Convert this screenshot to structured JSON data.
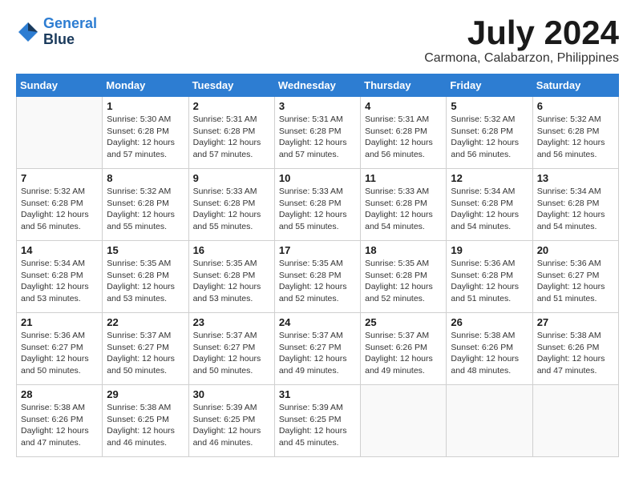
{
  "header": {
    "logo_line1": "General",
    "logo_line2": "Blue",
    "month_year": "July 2024",
    "location": "Carmona, Calabarzon, Philippines"
  },
  "days_of_week": [
    "Sunday",
    "Monday",
    "Tuesday",
    "Wednesday",
    "Thursday",
    "Friday",
    "Saturday"
  ],
  "weeks": [
    [
      {
        "day": "",
        "detail": ""
      },
      {
        "day": "1",
        "detail": "Sunrise: 5:30 AM\nSunset: 6:28 PM\nDaylight: 12 hours\nand 57 minutes."
      },
      {
        "day": "2",
        "detail": "Sunrise: 5:31 AM\nSunset: 6:28 PM\nDaylight: 12 hours\nand 57 minutes."
      },
      {
        "day": "3",
        "detail": "Sunrise: 5:31 AM\nSunset: 6:28 PM\nDaylight: 12 hours\nand 57 minutes."
      },
      {
        "day": "4",
        "detail": "Sunrise: 5:31 AM\nSunset: 6:28 PM\nDaylight: 12 hours\nand 56 minutes."
      },
      {
        "day": "5",
        "detail": "Sunrise: 5:32 AM\nSunset: 6:28 PM\nDaylight: 12 hours\nand 56 minutes."
      },
      {
        "day": "6",
        "detail": "Sunrise: 5:32 AM\nSunset: 6:28 PM\nDaylight: 12 hours\nand 56 minutes."
      }
    ],
    [
      {
        "day": "7",
        "detail": "Sunrise: 5:32 AM\nSunset: 6:28 PM\nDaylight: 12 hours\nand 56 minutes."
      },
      {
        "day": "8",
        "detail": "Sunrise: 5:32 AM\nSunset: 6:28 PM\nDaylight: 12 hours\nand 55 minutes."
      },
      {
        "day": "9",
        "detail": "Sunrise: 5:33 AM\nSunset: 6:28 PM\nDaylight: 12 hours\nand 55 minutes."
      },
      {
        "day": "10",
        "detail": "Sunrise: 5:33 AM\nSunset: 6:28 PM\nDaylight: 12 hours\nand 55 minutes."
      },
      {
        "day": "11",
        "detail": "Sunrise: 5:33 AM\nSunset: 6:28 PM\nDaylight: 12 hours\nand 54 minutes."
      },
      {
        "day": "12",
        "detail": "Sunrise: 5:34 AM\nSunset: 6:28 PM\nDaylight: 12 hours\nand 54 minutes."
      },
      {
        "day": "13",
        "detail": "Sunrise: 5:34 AM\nSunset: 6:28 PM\nDaylight: 12 hours\nand 54 minutes."
      }
    ],
    [
      {
        "day": "14",
        "detail": "Sunrise: 5:34 AM\nSunset: 6:28 PM\nDaylight: 12 hours\nand 53 minutes."
      },
      {
        "day": "15",
        "detail": "Sunrise: 5:35 AM\nSunset: 6:28 PM\nDaylight: 12 hours\nand 53 minutes."
      },
      {
        "day": "16",
        "detail": "Sunrise: 5:35 AM\nSunset: 6:28 PM\nDaylight: 12 hours\nand 53 minutes."
      },
      {
        "day": "17",
        "detail": "Sunrise: 5:35 AM\nSunset: 6:28 PM\nDaylight: 12 hours\nand 52 minutes."
      },
      {
        "day": "18",
        "detail": "Sunrise: 5:35 AM\nSunset: 6:28 PM\nDaylight: 12 hours\nand 52 minutes."
      },
      {
        "day": "19",
        "detail": "Sunrise: 5:36 AM\nSunset: 6:28 PM\nDaylight: 12 hours\nand 51 minutes."
      },
      {
        "day": "20",
        "detail": "Sunrise: 5:36 AM\nSunset: 6:27 PM\nDaylight: 12 hours\nand 51 minutes."
      }
    ],
    [
      {
        "day": "21",
        "detail": "Sunrise: 5:36 AM\nSunset: 6:27 PM\nDaylight: 12 hours\nand 50 minutes."
      },
      {
        "day": "22",
        "detail": "Sunrise: 5:37 AM\nSunset: 6:27 PM\nDaylight: 12 hours\nand 50 minutes."
      },
      {
        "day": "23",
        "detail": "Sunrise: 5:37 AM\nSunset: 6:27 PM\nDaylight: 12 hours\nand 50 minutes."
      },
      {
        "day": "24",
        "detail": "Sunrise: 5:37 AM\nSunset: 6:27 PM\nDaylight: 12 hours\nand 49 minutes."
      },
      {
        "day": "25",
        "detail": "Sunrise: 5:37 AM\nSunset: 6:26 PM\nDaylight: 12 hours\nand 49 minutes."
      },
      {
        "day": "26",
        "detail": "Sunrise: 5:38 AM\nSunset: 6:26 PM\nDaylight: 12 hours\nand 48 minutes."
      },
      {
        "day": "27",
        "detail": "Sunrise: 5:38 AM\nSunset: 6:26 PM\nDaylight: 12 hours\nand 47 minutes."
      }
    ],
    [
      {
        "day": "28",
        "detail": "Sunrise: 5:38 AM\nSunset: 6:26 PM\nDaylight: 12 hours\nand 47 minutes."
      },
      {
        "day": "29",
        "detail": "Sunrise: 5:38 AM\nSunset: 6:25 PM\nDaylight: 12 hours\nand 46 minutes."
      },
      {
        "day": "30",
        "detail": "Sunrise: 5:39 AM\nSunset: 6:25 PM\nDaylight: 12 hours\nand 46 minutes."
      },
      {
        "day": "31",
        "detail": "Sunrise: 5:39 AM\nSunset: 6:25 PM\nDaylight: 12 hours\nand 45 minutes."
      },
      {
        "day": "",
        "detail": ""
      },
      {
        "day": "",
        "detail": ""
      },
      {
        "day": "",
        "detail": ""
      }
    ]
  ]
}
